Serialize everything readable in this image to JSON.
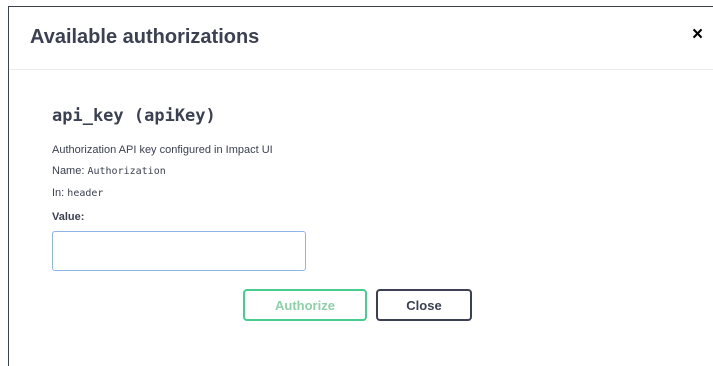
{
  "modal": {
    "title": "Available authorizations",
    "close_icon": "×"
  },
  "scheme": {
    "title": "api_key (apiKey)",
    "description": "Authorization API key configured in Impact UI",
    "name_label": "Name:",
    "name_value": "Authorization",
    "in_label": "In:",
    "in_value": "header",
    "value_label": "Value:",
    "value_input": ""
  },
  "buttons": {
    "authorize_label": "Authorize",
    "close_label": "Close"
  },
  "colors": {
    "authorize_border": "#49cc90",
    "input_border": "#8fb4e8",
    "text": "#3b4151"
  }
}
